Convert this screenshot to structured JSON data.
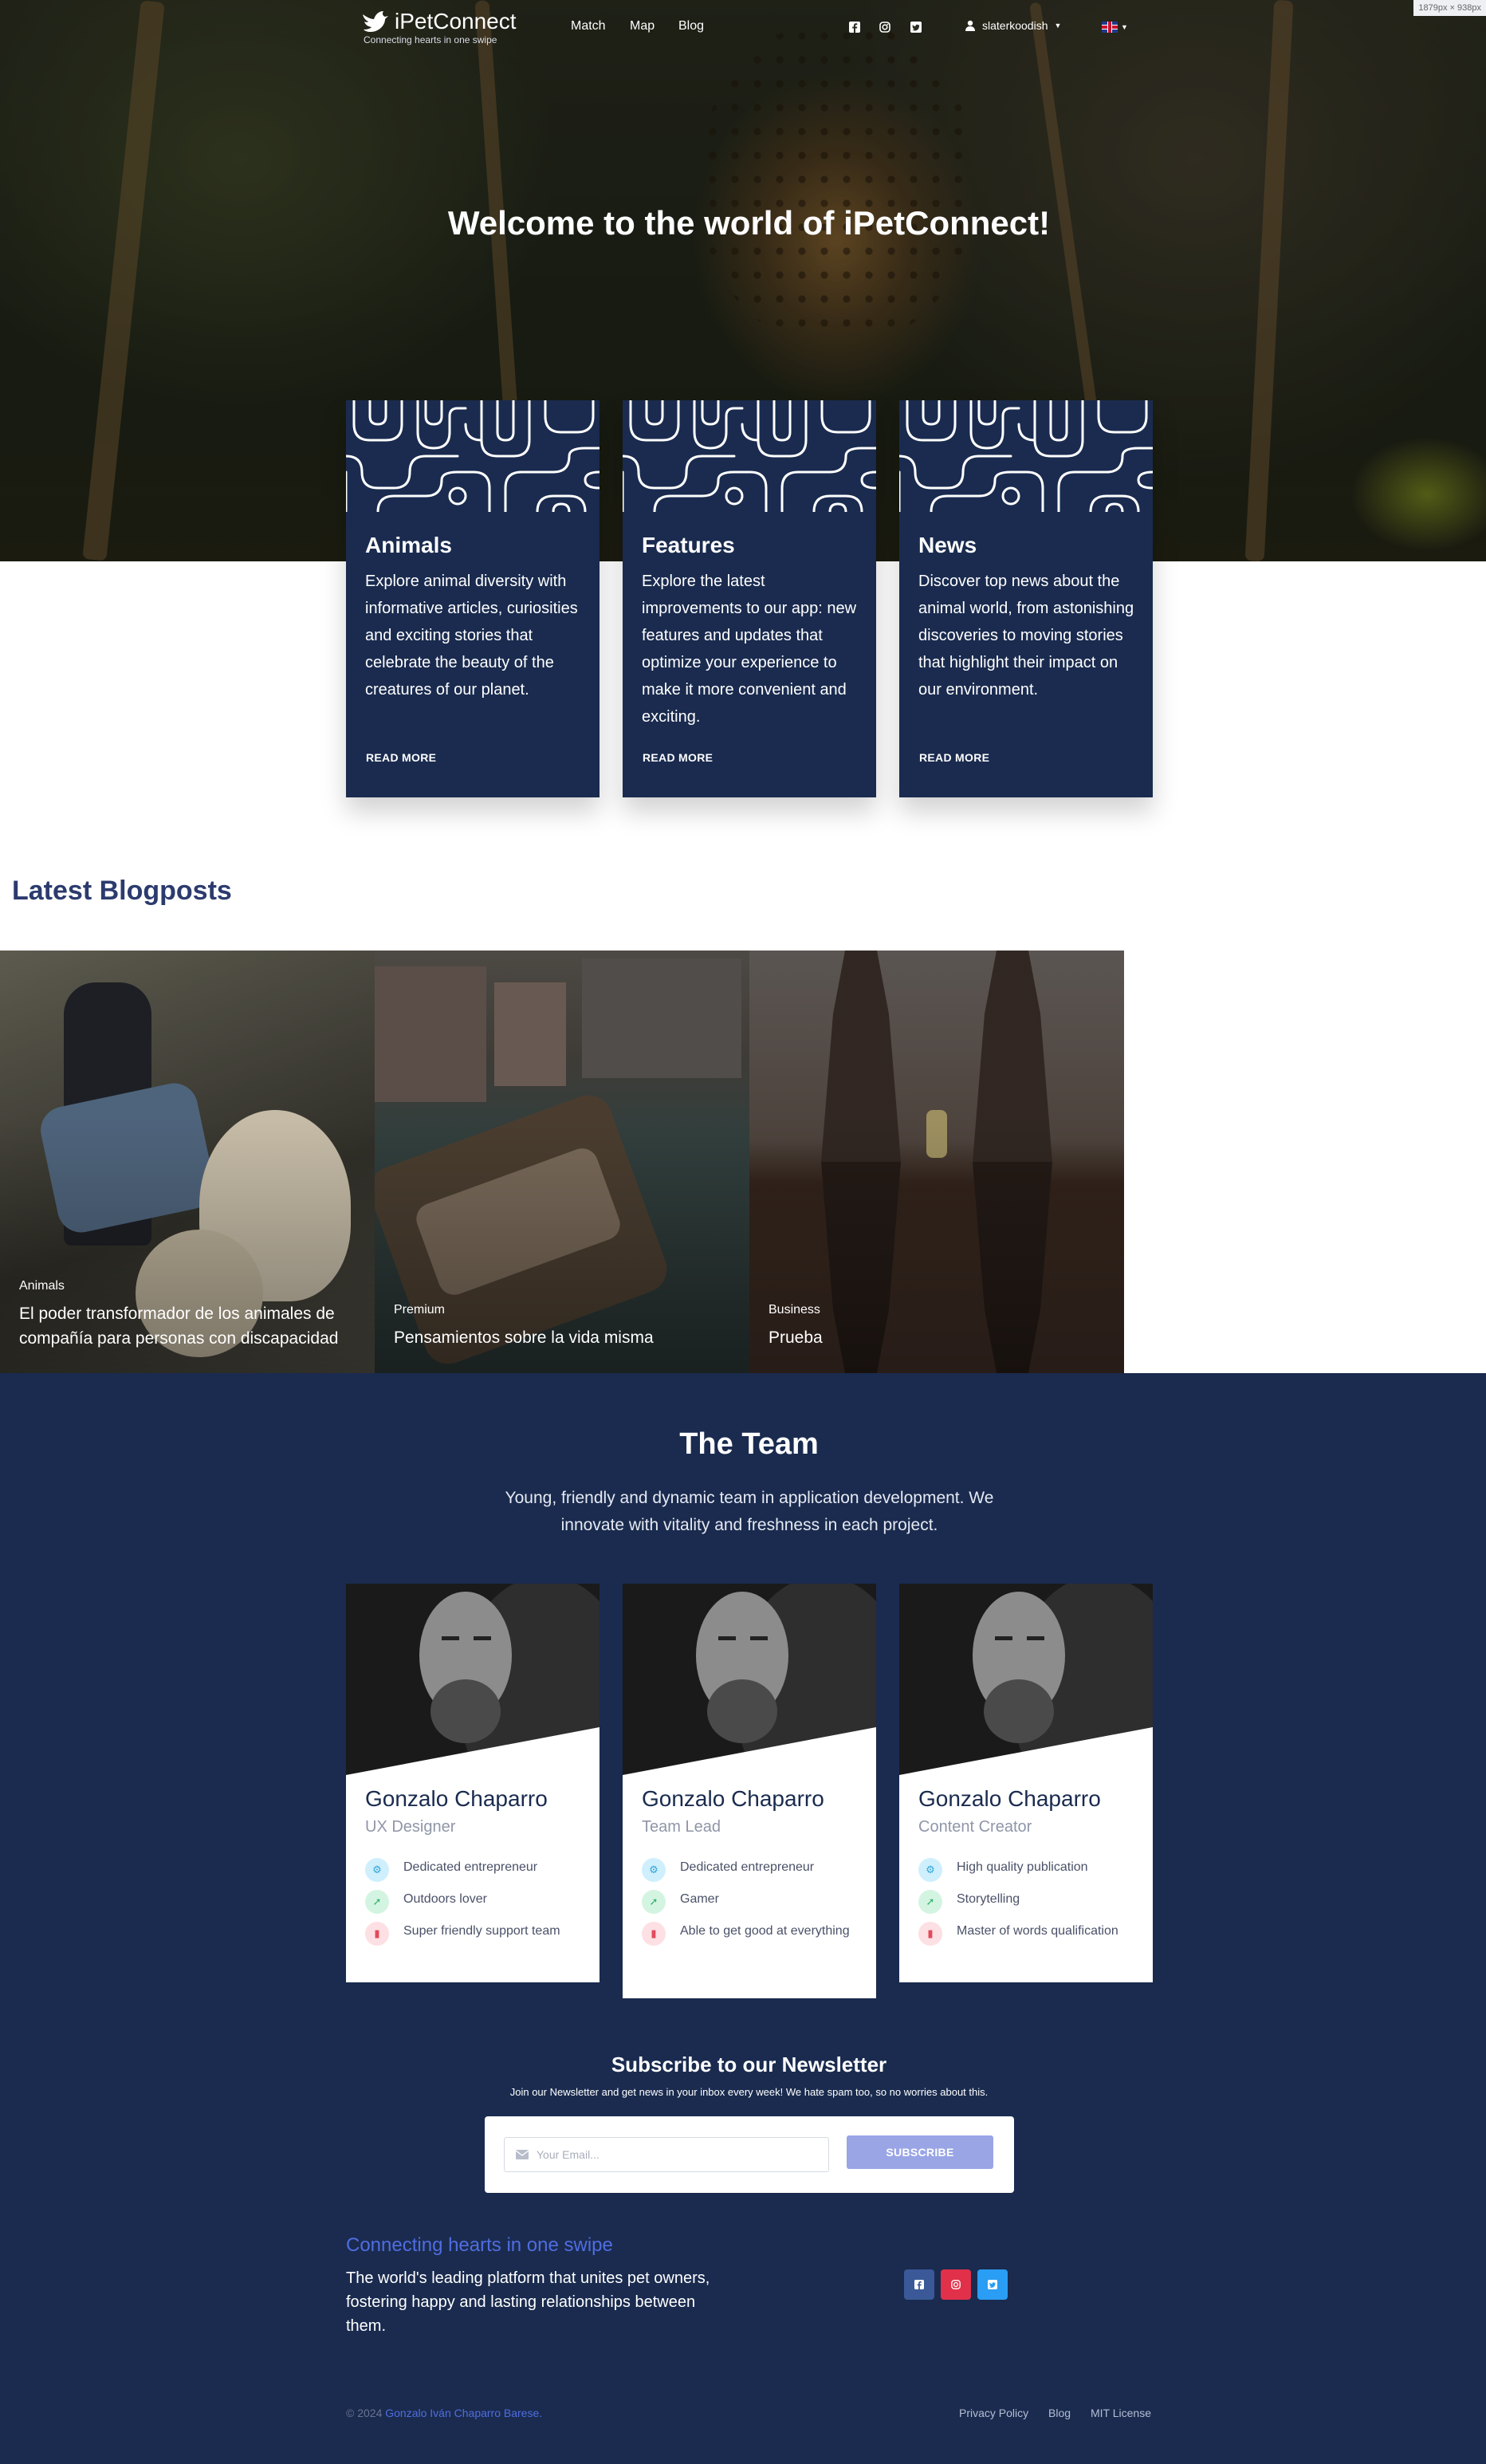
{
  "window": {
    "size_badge": "1879px × 938px"
  },
  "nav": {
    "brand_name": "iPetConnect",
    "brand_tagline": "Connecting hearts in one swipe",
    "links": [
      "Match",
      "Map",
      "Blog"
    ],
    "social_icons": [
      "facebook-icon",
      "instagram-icon",
      "twitter-icon"
    ],
    "username": "slaterkoodish",
    "language": "english-flag-icon"
  },
  "hero": {
    "title": "Welcome to the world of iPetConnect!"
  },
  "features": [
    {
      "title": "Animals",
      "text": "Explore animal diversity with informative articles, curiosities and exciting stories that celebrate the beauty of the creatures of our planet.",
      "cta": "READ MORE"
    },
    {
      "title": "Features",
      "text": "Explore the latest improvements to our app: new features and updates that optimize your experience to make it more convenient and exciting.",
      "cta": "READ MORE"
    },
    {
      "title": "News",
      "text": "Discover top news about the animal world, from astonishing discoveries to moving stories that highlight their impact on our environment.",
      "cta": "READ MORE"
    }
  ],
  "blog": {
    "heading": "Latest Blogposts",
    "posts": [
      {
        "category": "Animals",
        "title": "El poder transformador de los animales de compañía para personas con discapacidad"
      },
      {
        "category": "Premium",
        "title": "Pensamientos sobre la vida misma"
      },
      {
        "category": "Business",
        "title": "Prueba"
      }
    ]
  },
  "team": {
    "title": "The Team",
    "subtitle": "Young, friendly and dynamic team in application development. We innovate with vitality and freshness in each project.",
    "members": [
      {
        "name": "Gonzalo Chaparro",
        "role": "UX Designer",
        "traits": [
          "Dedicated entrepreneur",
          "Outdoors lover",
          "Super friendly support team"
        ]
      },
      {
        "name": "Gonzalo Chaparro",
        "role": "Team Lead",
        "traits": [
          "Dedicated entrepreneur",
          "Gamer",
          "Able to get good at everything"
        ]
      },
      {
        "name": "Gonzalo Chaparro",
        "role": "Content Creator",
        "traits": [
          "High quality publication",
          "Storytelling",
          "Master of words qualification"
        ]
      }
    ]
  },
  "newsletter": {
    "title": "Subscribe to our Newsletter",
    "subtitle": "Join our Newsletter and get news in your inbox every week! We hate spam too, so no worries about this.",
    "placeholder": "Your Email...",
    "button": "SUBSCRIBE"
  },
  "footer": {
    "tagline": "Connecting hearts in one swipe",
    "description": "The world's leading platform that unites pet owners, fostering happy and lasting relationships between them.",
    "copyright_prefix": "© 2024",
    "author": "Gonzalo Iván Chaparro Barese.",
    "links": [
      "Privacy Policy",
      "Blog",
      "MIT License"
    ]
  },
  "colors": {
    "navy": "#1a2b4f",
    "accent": "#4f6de0",
    "subscribe": "#9aa5e6"
  }
}
